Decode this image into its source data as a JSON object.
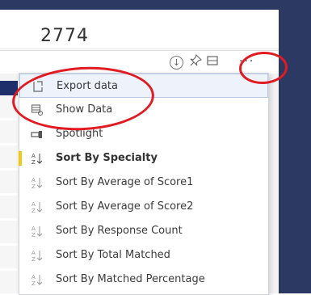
{
  "kpi": {
    "value": "2774"
  },
  "visual_header": {
    "icons": [
      "download-icon",
      "pin-icon",
      "focus-mode-icon",
      "more-options-icon"
    ],
    "more_label": "···"
  },
  "context_menu": {
    "items": [
      {
        "label": "Export data",
        "icon": "export-icon",
        "state": "hover"
      },
      {
        "label": "Show Data",
        "icon": "show-data-icon",
        "state": "normal"
      },
      {
        "label": "Spotlight",
        "icon": "spotlight-icon",
        "state": "normal"
      },
      {
        "label": "Sort By Specialty",
        "icon": "sort-icon",
        "state": "selected"
      },
      {
        "label": "Sort By Average of Score1",
        "icon": "sort-icon",
        "state": "normal"
      },
      {
        "label": "Sort By Average of Score2",
        "icon": "sort-icon",
        "state": "normal"
      },
      {
        "label": "Sort By Response Count",
        "icon": "sort-icon",
        "state": "normal"
      },
      {
        "label": "Sort By Total Matched",
        "icon": "sort-icon",
        "state": "normal"
      },
      {
        "label": "Sort By Matched Percentage",
        "icon": "sort-icon",
        "state": "normal"
      }
    ]
  },
  "colors": {
    "frame": "#2c3a63",
    "annotation": "#e01b22",
    "selected_marker": "#f2c811",
    "hover_bg": "#edf2fb"
  }
}
